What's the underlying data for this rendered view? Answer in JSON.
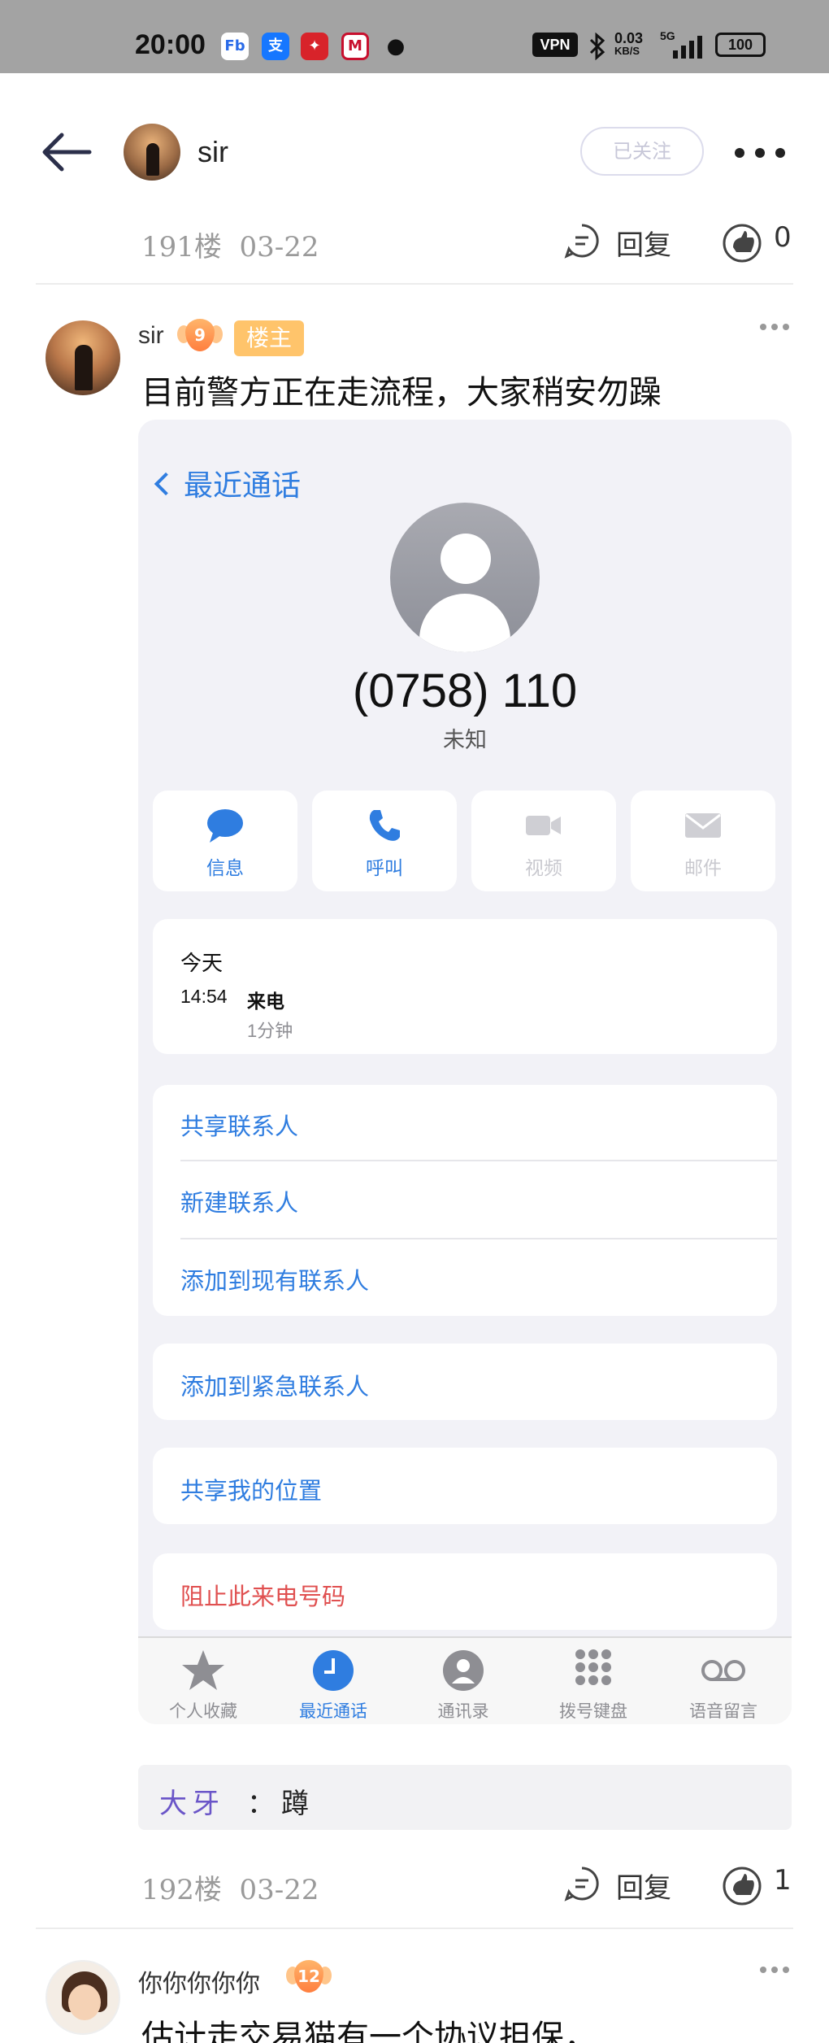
{
  "status_bar": {
    "time": "20:00",
    "vpn": "VPN",
    "net_speed": "0.03",
    "net_unit": "KB/S",
    "signal": "5G",
    "battery": "100"
  },
  "header": {
    "username": "sir",
    "follow_label": "已关注"
  },
  "floor_191": {
    "floor": "191楼",
    "date": "03-22",
    "reply_label": "回复",
    "like_count": "0"
  },
  "post": {
    "username": "sir",
    "level": "9",
    "host_tag": "楼主",
    "text": "目前警方正在走流程，大家稍安勿躁"
  },
  "call_screenshot": {
    "back_label": "最近通话",
    "phone_number": "(0758) 110",
    "caller_label": "未知",
    "actions": [
      {
        "label": "信息",
        "icon": "message-icon",
        "enabled": true
      },
      {
        "label": "呼叫",
        "icon": "phone-icon",
        "enabled": true
      },
      {
        "label": "视频",
        "icon": "video-icon",
        "enabled": false
      },
      {
        "label": "邮件",
        "icon": "mail-icon",
        "enabled": false
      }
    ],
    "history": {
      "day": "今天",
      "time": "14:54",
      "type": "来电",
      "duration": "1分钟"
    },
    "options_group": [
      "共享联系人",
      "新建联系人",
      "添加到现有联系人"
    ],
    "emergency": "添加到紧急联系人",
    "share_location": "共享我的位置",
    "block": "阻止此来电号码",
    "tabs": [
      {
        "label": "个人收藏",
        "icon": "star-icon"
      },
      {
        "label": "最近通话",
        "icon": "clock-icon"
      },
      {
        "label": "通讯录",
        "icon": "contacts-icon"
      },
      {
        "label": "拨号键盘",
        "icon": "keypad-icon"
      },
      {
        "label": "语音留言",
        "icon": "voicemail-icon"
      }
    ],
    "active_tab": "最近通话"
  },
  "sub_reply": {
    "name": "大牙",
    "colon": "：",
    "text": "蹲"
  },
  "floor_192": {
    "floor": "192楼",
    "date": "03-22",
    "reply_label": "回复",
    "like_count": "1"
  },
  "post2": {
    "username": "你你你你你",
    "level": "12",
    "text": "估计走交易猫有一个协议担保，"
  },
  "colors": {
    "ios_blue": "#2f7de0",
    "ios_red": "#e05050",
    "sub_reply_name": "#6a55c8",
    "host_tag": "#ffc46b"
  }
}
